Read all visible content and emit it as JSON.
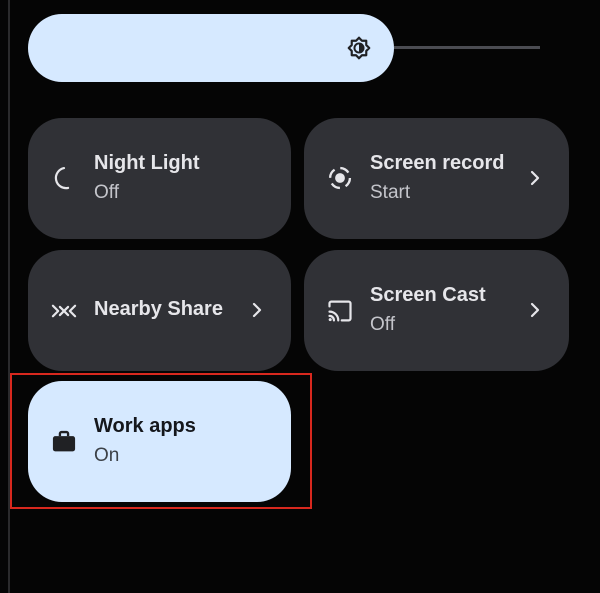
{
  "tiles": [
    {
      "title": "Night Light",
      "subtitle": "Off",
      "icon": "moon-icon",
      "has_chevron": false,
      "active": false
    },
    {
      "title": "Screen record",
      "subtitle": "Start",
      "icon": "screen-record-icon",
      "has_chevron": true,
      "active": false
    },
    {
      "title": "Nearby Share",
      "subtitle": "",
      "icon": "nearby-share-icon",
      "has_chevron": true,
      "active": false
    },
    {
      "title": "Screen Cast",
      "subtitle": "Off",
      "icon": "cast-icon",
      "has_chevron": true,
      "active": false
    },
    {
      "title": "Work apps",
      "subtitle": "On",
      "icon": "briefcase-icon",
      "has_chevron": false,
      "active": true
    }
  ],
  "brightness": {
    "icon": "brightness-icon"
  },
  "colors": {
    "background": "#050505",
    "tile": "#303136",
    "tile_active": "#d6e9ff",
    "highlight": "#d8281e"
  }
}
